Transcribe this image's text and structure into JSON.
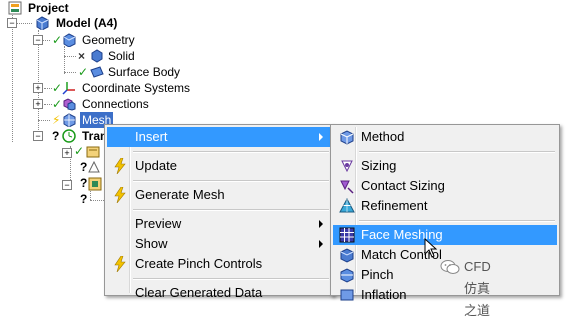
{
  "tree": {
    "project": "Project",
    "model": "Model (A4)",
    "geometry": "Geometry",
    "solid": "Solid",
    "surface_body": "Surface Body",
    "coordinate_systems": "Coordinate Systems",
    "connections": "Connections",
    "mesh": "Mesh",
    "transient_partial": "Tran"
  },
  "context_menu": {
    "items": [
      {
        "label": "Insert",
        "icon": "none",
        "submenu": true
      },
      {
        "label": "Update",
        "icon": "lightning-icon"
      },
      {
        "label": "Generate Mesh",
        "icon": "lightning-icon"
      },
      {
        "label": "Preview",
        "submenu": true
      },
      {
        "label": "Show",
        "submenu": true
      },
      {
        "label": "Create Pinch Controls",
        "icon": "lightning-icon"
      },
      {
        "label": "Clear Generated Data",
        "icon": "none"
      }
    ]
  },
  "insert_submenu": {
    "items": [
      {
        "label": "Method",
        "icon": "method-icon"
      },
      {
        "label": "Sizing",
        "icon": "sizing-icon"
      },
      {
        "label": "Contact Sizing",
        "icon": "contact-sizing-icon"
      },
      {
        "label": "Refinement",
        "icon": "refinement-icon"
      },
      {
        "label": "Face Meshing",
        "icon": "face-meshing-icon",
        "highlighted": true
      },
      {
        "label": "Match Control",
        "icon": "match-control-icon"
      },
      {
        "label": "Pinch",
        "icon": "pinch-icon"
      },
      {
        "label": "Inflation",
        "icon": "inflation-icon"
      }
    ]
  },
  "watermark": "CFD仿真之道",
  "colors": {
    "selection": "#3c6fc8",
    "menu_highlight": "#3399ff",
    "menu_bg": "#f0f0f0",
    "check_green": "#1a9a1a",
    "lightning_yellow": "#f2c200"
  }
}
